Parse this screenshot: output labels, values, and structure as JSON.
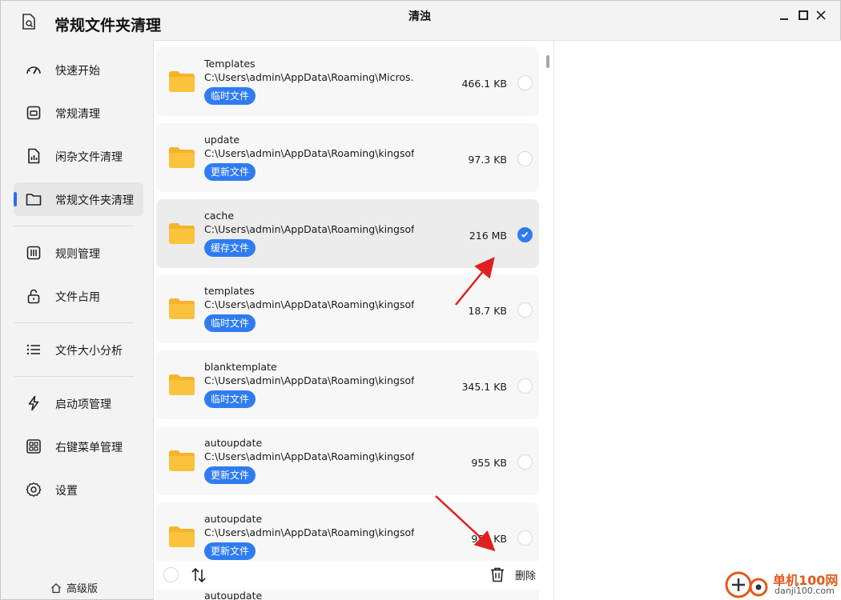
{
  "app": {
    "title": "常规文件夹清理",
    "window_title": "清浊"
  },
  "sidebar": {
    "items": [
      {
        "label": "快速开始",
        "icon": "speedometer-icon"
      },
      {
        "label": "常规清理",
        "icon": "cleanup-icon"
      },
      {
        "label": "闲杂文件清理",
        "icon": "file-chart-icon"
      },
      {
        "label": "常规文件夹清理",
        "icon": "folder-icon",
        "active": true
      },
      {
        "label": "规则管理",
        "icon": "rules-icon"
      },
      {
        "label": "文件占用",
        "icon": "unlock-icon"
      },
      {
        "label": "文件大小分析",
        "icon": "list-icon"
      },
      {
        "label": "启动项管理",
        "icon": "lightning-icon"
      },
      {
        "label": "右键菜单管理",
        "icon": "grid-menu-icon"
      },
      {
        "label": "设置",
        "icon": "gear-icon"
      }
    ],
    "pro_label": "高级版"
  },
  "folders": [
    {
      "name": "Templates",
      "path": "C:\\Users\\admin\\AppData\\Roaming\\Micros...",
      "tag": "临时文件",
      "size": "466.1 KB",
      "checked": false
    },
    {
      "name": "update",
      "path": "C:\\Users\\admin\\AppData\\Roaming\\kingsof...",
      "tag": "更新文件",
      "size": "97.3 KB",
      "checked": false
    },
    {
      "name": "cache",
      "path": "C:\\Users\\admin\\AppData\\Roaming\\kingsof...",
      "tag": "缓存文件",
      "size": "216 MB",
      "checked": true
    },
    {
      "name": "templates",
      "path": "C:\\Users\\admin\\AppData\\Roaming\\kingsof...",
      "tag": "临时文件",
      "size": "18.7 KB",
      "checked": false
    },
    {
      "name": "blanktemplate",
      "path": "C:\\Users\\admin\\AppData\\Roaming\\kingsof...",
      "tag": "临时文件",
      "size": "345.1 KB",
      "checked": false
    },
    {
      "name": "autoupdate",
      "path": "C:\\Users\\admin\\AppData\\Roaming\\kingsof...",
      "tag": "更新文件",
      "size": "955 KB",
      "checked": false
    },
    {
      "name": "autoupdate",
      "path": "C:\\Users\\admin\\AppData\\Roaming\\kingsof...",
      "tag": "更新文件",
      "size": "955 KB",
      "checked": false
    },
    {
      "name": "autoupdate",
      "path": "",
      "tag": "",
      "size": "",
      "checked": false
    }
  ],
  "actions": {
    "delete_label": "删除"
  },
  "watermark": {
    "text": "单机100网",
    "sub": "danji100.com"
  },
  "colors": {
    "accent": "#2f7cf0",
    "indicator": "#2f6fe4",
    "folder": "#f6b32a",
    "arrow": "#e02020"
  }
}
